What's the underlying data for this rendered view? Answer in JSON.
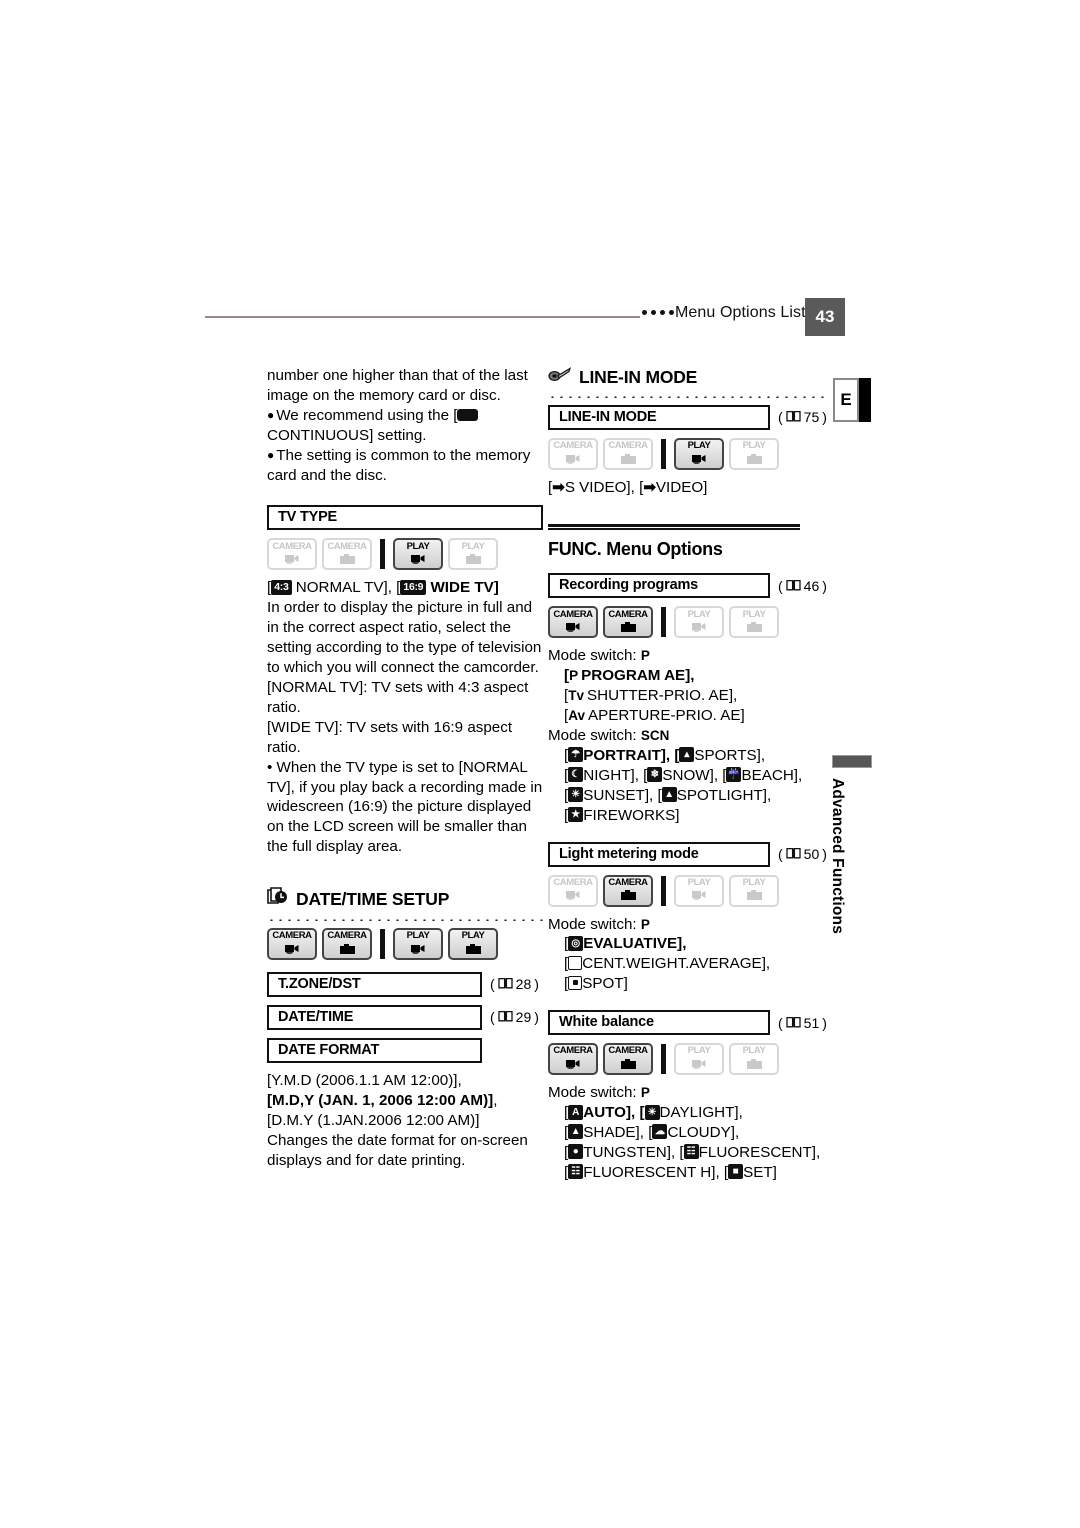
{
  "header": {
    "title": "Menu Options Lists",
    "page_number": "43"
  },
  "edge_tabs": {
    "letter": "E",
    "side_label": "Advanced Functions"
  },
  "mode_labels": {
    "camera": "CAMERA",
    "play": "PLAY"
  },
  "left_column": {
    "intro": {
      "line1": "number one higher than that of the last",
      "line2": "image on the memory card or disc.",
      "bullet1_a": "We recommend using the [",
      "bullet1_b": "CONTINUOUS] setting.",
      "bullet2": "The setting is common to the memory card and the disc."
    },
    "tv_type": {
      "menu_label": "TV TYPE",
      "modes": [
        "off",
        "off",
        "on",
        "off"
      ],
      "options_a": "NORMAL TV], [",
      "options_prefix": "[",
      "ratio_43": "4:3",
      "ratio_169": "16:9",
      "options_b": "WIDE TV]",
      "body1": "In order to display the picture in full and in the correct aspect ratio, select the setting according to the type of television to which you will connect the camcorder.",
      "body2": "[NORMAL TV]: TV sets with 4:3 aspect ratio.",
      "body3": "[WIDE TV]: TV sets with 16:9 aspect ratio.",
      "body4": "• When the TV type is set to [NORMAL TV], if you play back a recording made in widescreen (16:9) the picture displayed on the LCD screen will be smaller than the full display area."
    },
    "date_time_setup": {
      "heading": "DATE/TIME SETUP",
      "icon": "calendar-clock-icon",
      "modes": [
        "on",
        "on",
        "on",
        "on"
      ],
      "rows": [
        {
          "label": "T.ZONE/DST",
          "ref": "28"
        },
        {
          "label": "DATE/TIME",
          "ref": "29"
        },
        {
          "label": "DATE FORMAT",
          "ref": ""
        }
      ],
      "opt1": "[Y.M.D (2006.1.1 AM 12:00)],",
      "opt2": "[M.D,Y (JAN. 1, 2006 12:00 AM)]",
      "opt2_tail": ",",
      "opt3": "[D.M.Y (1.JAN.2006 12:00 AM)]",
      "body": "Changes the date format for on-screen displays and for date printing."
    }
  },
  "right_column": {
    "line_in_mode": {
      "heading": "LINE-IN MODE",
      "icon": "plug-connector-icon",
      "menu_label": "LINE-IN MODE",
      "ref": "75",
      "modes": [
        "off",
        "off",
        "on",
        "off"
      ],
      "options": "S VIDEO], [",
      "options_head": "[",
      "options_tail": "VIDEO]"
    },
    "func_menu": {
      "title": "FUNC. Menu Options",
      "recording_programs": {
        "menu_label": "Recording programs",
        "ref": "46",
        "modes": [
          "on",
          "on",
          "off",
          "off"
        ],
        "mode_switch_1_label": "Mode switch:",
        "mode_switch_1_value": "P",
        "p_prefix": "P",
        "opt_p_1": "PROGRAM AE],",
        "opt_tv_mark": "Tv",
        "opt_tv": "SHUTTER-PRIO. AE],",
        "opt_av_mark": "Av",
        "opt_av": "APERTURE-PRIO. AE]",
        "mode_switch_2_label": "Mode switch:",
        "mode_switch_2_value": "SCN",
        "scn_line1_a": "PORTRAIT], [",
        "scn_line1_b": "SPORTS],",
        "scn_line2_a": "NIGHT], [",
        "scn_line2_b": "SNOW], [",
        "scn_line2_c": "BEACH],",
        "scn_line3_a": "SUNSET], [",
        "scn_line3_b": "SPOTLIGHT],",
        "scn_line4": "FIREWORKS]"
      },
      "light_metering": {
        "menu_label": "Light metering mode",
        "ref": "50",
        "modes": [
          "off",
          "on",
          "off",
          "off"
        ],
        "mode_switch_label": "Mode switch:",
        "mode_switch_value": "P",
        "opt1": "EVALUATIVE],",
        "opt2": "CENT.WEIGHT.AVERAGE],",
        "opt3": "SPOT]"
      },
      "white_balance": {
        "menu_label": "White balance",
        "ref": "51",
        "modes": [
          "on",
          "on",
          "off",
          "off"
        ],
        "mode_switch_label": "Mode switch:",
        "mode_switch_value": "P",
        "line1_a": "AUTO], [",
        "line1_b": "DAYLIGHT],",
        "line2_a": "SHADE], [",
        "line2_b": "CLOUDY],",
        "line3_a": "TUNGSTEN], [",
        "line3_b": "FLUORESCENT],",
        "line4_a": "FLUORESCENT H], [",
        "line4_b": "SET]"
      }
    }
  }
}
